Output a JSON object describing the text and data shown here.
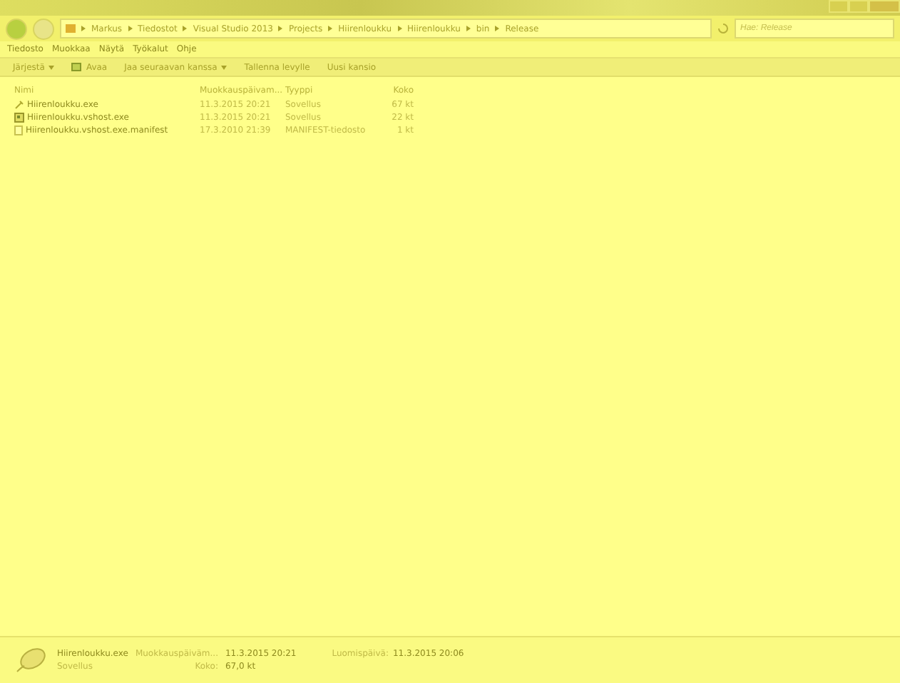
{
  "breadcrumb": [
    "Markus",
    "Tiedostot",
    "Visual Studio 2013",
    "Projects",
    "Hiirenloukku",
    "Hiirenloukku",
    "bin",
    "Release"
  ],
  "search": {
    "placeholder": "Hae: Release"
  },
  "menu": [
    "Tiedosto",
    "Muokkaa",
    "Näytä",
    "Työkalut",
    "Ohje"
  ],
  "toolbar": [
    {
      "label": "Järjestä",
      "dropdown": true,
      "icon": false
    },
    {
      "label": "Avaa",
      "dropdown": false,
      "icon": true
    },
    {
      "label": "Jaa seuraavan kanssa",
      "dropdown": true,
      "icon": false
    },
    {
      "label": "Tallenna levylle",
      "dropdown": false,
      "icon": false
    },
    {
      "label": "Uusi kansio",
      "dropdown": false,
      "icon": false
    }
  ],
  "columns": [
    "Nimi",
    "Muokkauspäivam...",
    "Tyyppi",
    "Koko"
  ],
  "files": [
    {
      "kind": "exe",
      "name": "Hiirenloukku.exe",
      "modified": "11.3.2015 20:21",
      "type": "Sovellus",
      "size": "67 kt"
    },
    {
      "kind": "app",
      "name": "Hiirenloukku.vshost.exe",
      "modified": "11.3.2015 20:21",
      "type": "Sovellus",
      "size": "22 kt"
    },
    {
      "kind": "doc",
      "name": "Hiirenloukku.vshost.exe.manifest",
      "modified": "17.3.2010 21:39",
      "type": "MANIFEST-tiedosto",
      "size": "1 kt"
    }
  ],
  "details": {
    "name": "Hiirenloukku.exe",
    "modified_label": "Muokkauspäiväm...",
    "modified": "11.3.2015 20:21",
    "created_label": "Luomispäivä:",
    "created": "11.3.2015 20:06",
    "type": "Sovellus",
    "size_label": "Koko:",
    "size": "67,0 kt"
  }
}
